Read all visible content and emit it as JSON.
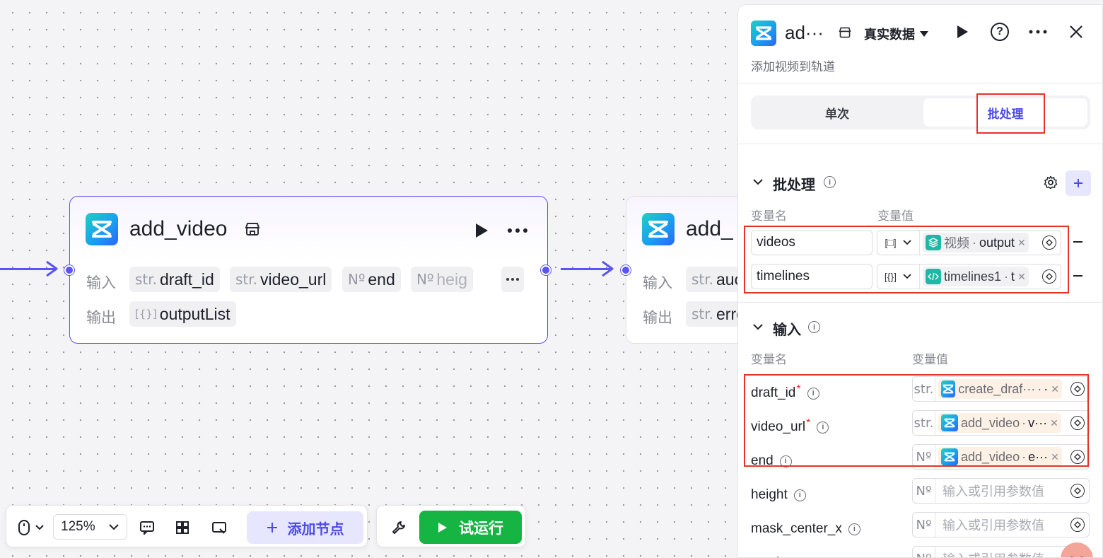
{
  "canvas": {
    "node1": {
      "title": "add_video",
      "input_label": "输入",
      "output_label": "输出",
      "inputs": [
        {
          "type": "str.",
          "name": "draft_id"
        },
        {
          "type": "str.",
          "name": "video_url"
        },
        {
          "type": "Nº",
          "name": "end"
        },
        {
          "type": "Nº",
          "name": "heig"
        }
      ],
      "output": {
        "type": "[{}]",
        "name": "outputList"
      },
      "more_label": "…"
    },
    "node2": {
      "title": "add_",
      "input_label": "输入",
      "output_label": "输出",
      "input_chip": {
        "type": "str.",
        "name": "auc"
      },
      "output_chip": {
        "type": "str.",
        "name": "erro"
      }
    }
  },
  "toolbar": {
    "zoom": "125%",
    "add_node_label": "添加节点",
    "run_label": "试运行"
  },
  "panel": {
    "title": "ad···",
    "data_mode": "真实数据",
    "subtitle": "添加视频到轨道",
    "tabs": [
      {
        "label": "单次",
        "active": false
      },
      {
        "label": "批处理",
        "active": true
      }
    ],
    "batch_section": {
      "title": "批处理",
      "col_name": "变量名",
      "col_value": "变量值",
      "rows": [
        {
          "name": "videos",
          "type_icon": "[□]",
          "ref_source": "视频",
          "ref_field": "output"
        },
        {
          "name": "timelines",
          "type_icon": "[{}]",
          "ref_source": "timelines1",
          "ref_field": "t"
        }
      ]
    },
    "input_section": {
      "title": "输入",
      "col_name": "变量名",
      "col_value": "变量值",
      "rows": [
        {
          "name": "draft_id",
          "required": "*",
          "type": "str.",
          "ref_source": "create_draf···",
          "ref_field": "·"
        },
        {
          "name": "video_url",
          "required": "*",
          "type": "str.",
          "ref_source": "add_video",
          "ref_field": "v···"
        },
        {
          "name": "end",
          "required": "",
          "type": "Nº",
          "ref_source": "add_video",
          "ref_field": "e···"
        },
        {
          "name": "height",
          "required": "",
          "type": "Nº",
          "placeholder": "输入或引用参数值"
        },
        {
          "name": "mask_center_x",
          "required": "",
          "type": "Nº",
          "placeholder": "输入或引用参数值"
        },
        {
          "name": "mask_center_y",
          "required": "",
          "type": "Nº",
          "placeholder": "输入或引用参数值"
        }
      ]
    }
  },
  "colors": {
    "accent": "#5a55f0",
    "run_green": "#16b443",
    "highlight_red": "#e5332a"
  }
}
